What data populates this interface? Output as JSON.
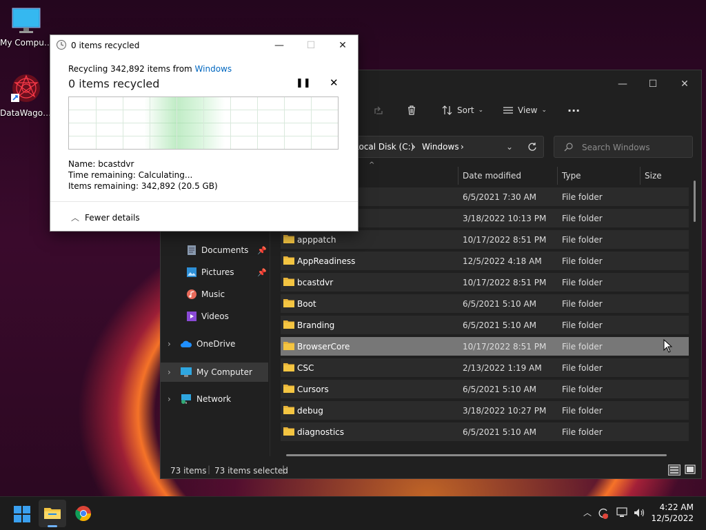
{
  "desktop": {
    "icons": [
      {
        "label": "My Computer"
      },
      {
        "label": "DataWagon..."
      }
    ]
  },
  "explorer": {
    "toolbar": {
      "sort_label": "Sort",
      "view_label": "View",
      "more_label": "···"
    },
    "address": {
      "segments": [
        "Local Disk (C:)",
        "Windows"
      ]
    },
    "search": {
      "placeholder": "Search Windows"
    },
    "columns": {
      "date": "Date modified",
      "type": "Type",
      "size": "Size"
    },
    "nav": [
      {
        "label": "Documents",
        "pinned": true
      },
      {
        "label": "Pictures",
        "pinned": true
      },
      {
        "label": "Music",
        "pinned": false
      },
      {
        "label": "Videos",
        "pinned": false
      },
      {
        "label": "OneDrive",
        "expandable": true
      },
      {
        "label": "My Computer",
        "expandable": true,
        "selected": true
      },
      {
        "label": "Network",
        "expandable": true
      }
    ],
    "rows": [
      {
        "name": "",
        "date": "6/5/2021 7:30 AM",
        "type": "File folder"
      },
      {
        "name": "",
        "date": "3/18/2022 10:13 PM",
        "type": "File folder"
      },
      {
        "name": "apppatch",
        "date": "10/17/2022 8:51 PM",
        "type": "File folder"
      },
      {
        "name": "AppReadiness",
        "date": "12/5/2022 4:18 AM",
        "type": "File folder"
      },
      {
        "name": "bcastdvr",
        "date": "10/17/2022 8:51 PM",
        "type": "File folder"
      },
      {
        "name": "Boot",
        "date": "6/5/2021 5:10 AM",
        "type": "File folder"
      },
      {
        "name": "Branding",
        "date": "6/5/2021 5:10 AM",
        "type": "File folder"
      },
      {
        "name": "BrowserCore",
        "date": "10/17/2022 8:51 PM",
        "type": "File folder",
        "selected": true
      },
      {
        "name": "CSC",
        "date": "2/13/2022 1:19 AM",
        "type": "File folder"
      },
      {
        "name": "Cursors",
        "date": "6/5/2021 5:10 AM",
        "type": "File folder"
      },
      {
        "name": "debug",
        "date": "3/18/2022 10:27 PM",
        "type": "File folder"
      },
      {
        "name": "diagnostics",
        "date": "6/5/2021 5:10 AM",
        "type": "File folder"
      }
    ],
    "status": {
      "items": "73 items",
      "selected": "73 items selected"
    }
  },
  "dialog": {
    "title": "0 items recycled",
    "source_prefix": "Recycling 342,892 items from ",
    "source_link": "Windows",
    "heading": "0 items recycled",
    "progress_fraction": 0.0,
    "name_label": "Name:",
    "name_value": "bcastdvr",
    "time_label": "Time remaining:",
    "time_value": "Calculating...",
    "items_label": "Items remaining:",
    "items_value": "342,892 (20.5 GB)",
    "fewer_details": "Fewer details"
  },
  "taskbar": {
    "time": "4:22 AM",
    "date": "12/5/2022"
  },
  "colors": {
    "accent": "#0067c0",
    "folder": "#f4c542",
    "selected_row": "#777777"
  }
}
